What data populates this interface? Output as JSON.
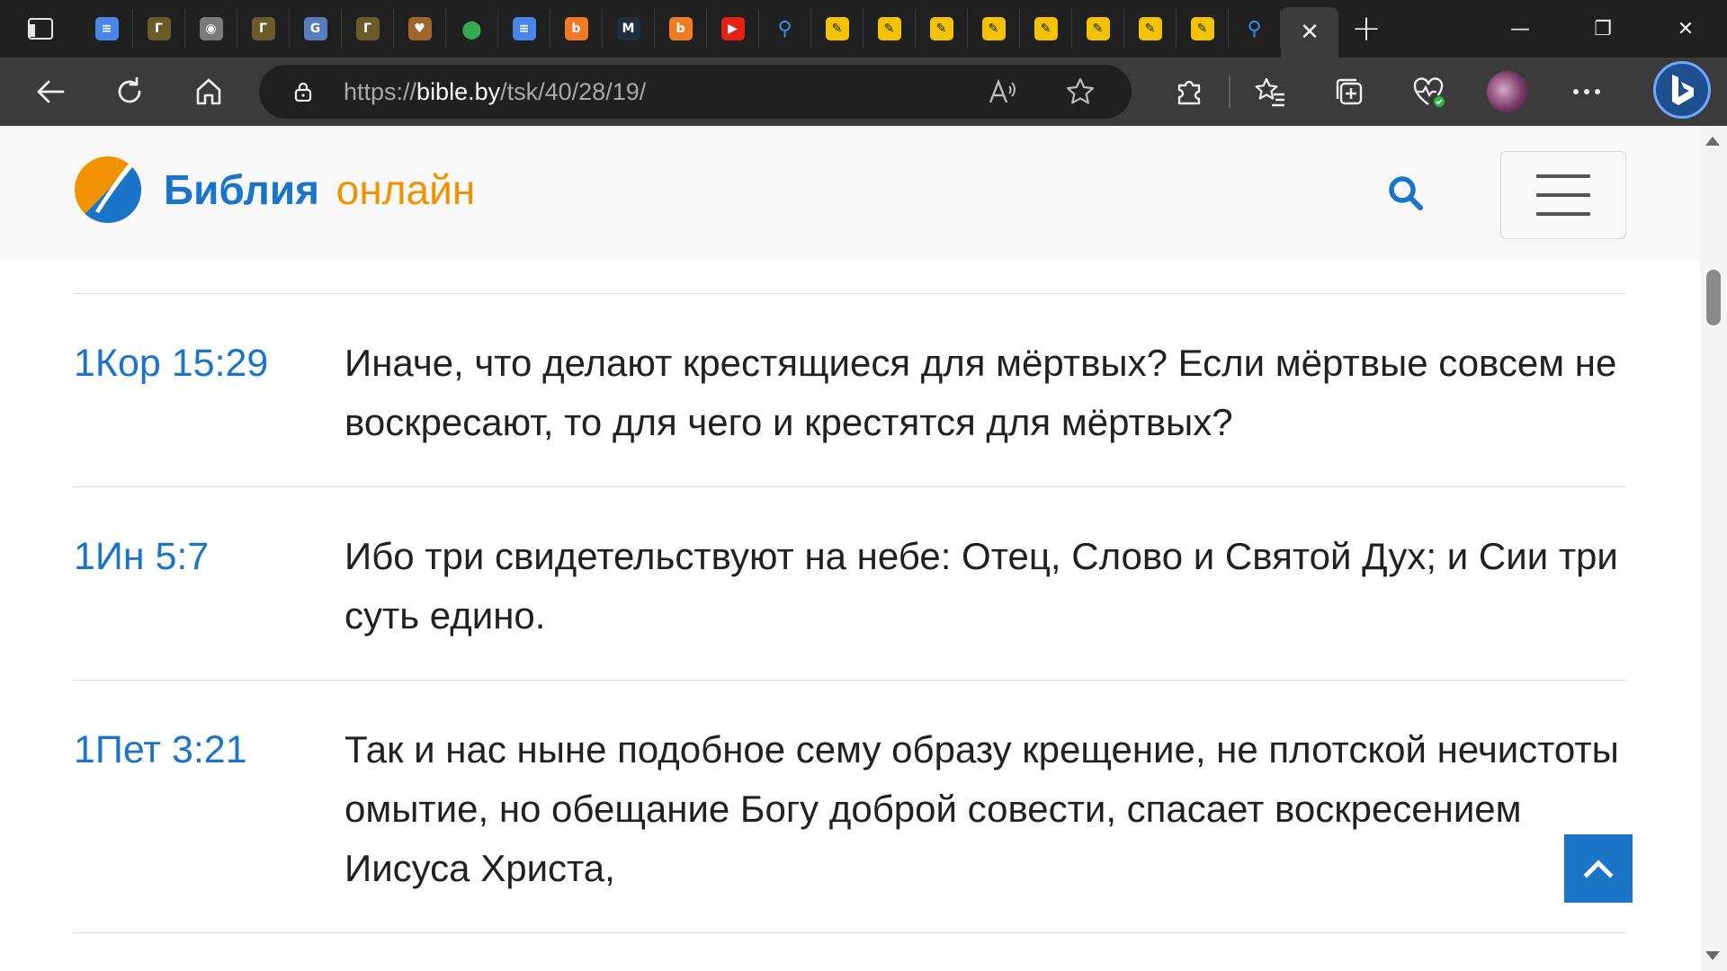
{
  "browser": {
    "url_prefix": "https://",
    "url_domain": "bible.by",
    "url_path": "/tsk/40/28/19/",
    "tabs": [
      {
        "icon": "docs-icon",
        "color": "#4a86e8"
      },
      {
        "icon": "site-t-icon",
        "color": "#6b5a2a"
      },
      {
        "icon": "palette-icon",
        "color": "#7a7a7a"
      },
      {
        "icon": "site-t-icon",
        "color": "#6b5a2a"
      },
      {
        "icon": "translate-icon",
        "color": "#5b7bb8"
      },
      {
        "icon": "site-t-icon",
        "color": "#6b5a2a"
      },
      {
        "icon": "heart-hand-icon",
        "color": "#a0642d"
      },
      {
        "icon": "maps-icon",
        "color": "#34a853"
      },
      {
        "icon": "docs-icon",
        "color": "#4a86e8"
      },
      {
        "icon": "b-orange-icon",
        "color": "#f07b22"
      },
      {
        "icon": "m-icon",
        "color": "#1f2f3f"
      },
      {
        "icon": "b-orange-icon",
        "color": "#f07b22"
      },
      {
        "icon": "youtube-icon",
        "color": "#e62117"
      },
      {
        "icon": "search-tab-icon",
        "color": "#202020"
      },
      {
        "icon": "feather-icon",
        "color": "#f3c200"
      },
      {
        "icon": "feather-icon",
        "color": "#f3c200"
      },
      {
        "icon": "feather-icon",
        "color": "#f3c200"
      },
      {
        "icon": "feather-icon",
        "color": "#f3c200"
      },
      {
        "icon": "feather-icon",
        "color": "#f3c200"
      },
      {
        "icon": "feather-icon",
        "color": "#f3c200"
      },
      {
        "icon": "feather-icon",
        "color": "#f3c200"
      },
      {
        "icon": "feather-icon",
        "color": "#f3c200"
      },
      {
        "icon": "search-tab-icon",
        "color": "#202020"
      }
    ]
  },
  "site": {
    "logo_word1": "Библия",
    "logo_word2": "онлайн",
    "brand_blue": "#1a74c7",
    "brand_orange": "#f39200"
  },
  "references": [
    {
      "ref": "1Кор 15:29",
      "text": "Иначе, что делают крестящиеся для мёртвых? Если мёртвые совсем не воскресают, то для чего и крестятся для мёртвых?"
    },
    {
      "ref": "1Ин 5:7",
      "text": "Ибо три свидетельствуют на небе: Отец, Слово и Святой Дух; и Сии три суть едино."
    },
    {
      "ref": "1Пет 3:21",
      "text": "Так и нас ныне подобное сему образу крещение, не плотской нечистоты омытие, но обещание Богу доброй совести, спасает воскресением Иисуса Христа,"
    }
  ]
}
